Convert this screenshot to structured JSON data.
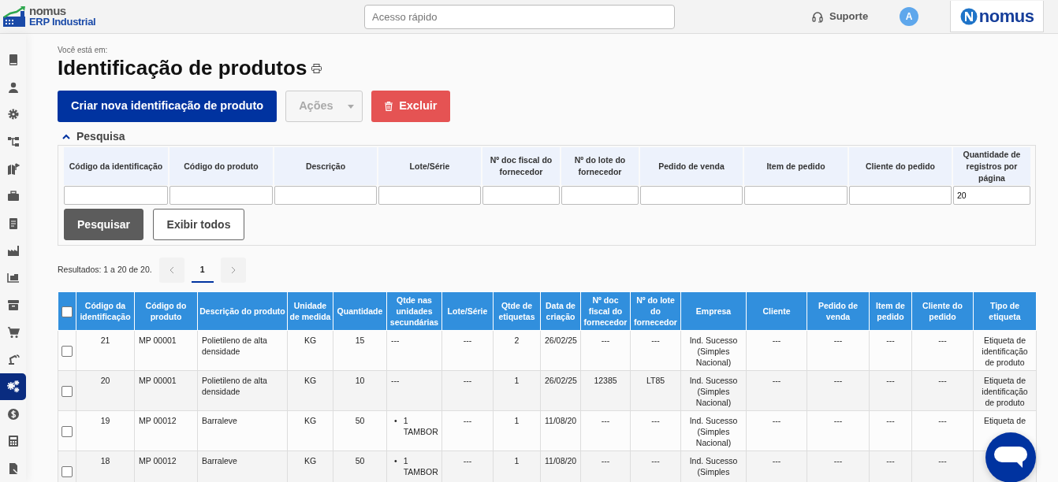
{
  "header": {
    "logo": {
      "brand": "nomus",
      "product": "ERP Industrial"
    },
    "quick_access": {
      "placeholder": "Acesso rápido"
    },
    "support": "Suporte",
    "avatar": "A",
    "brand_logo": "nomus"
  },
  "sidebar": {
    "items": [
      {
        "selected": false
      },
      {
        "selected": false
      },
      {
        "selected": false
      },
      {
        "selected": false
      },
      {
        "selected": false
      },
      {
        "selected": false
      },
      {
        "selected": false
      },
      {
        "selected": false
      },
      {
        "selected": false
      },
      {
        "selected": false
      },
      {
        "selected": false
      },
      {
        "selected": false
      },
      {
        "selected": true
      },
      {
        "selected": false
      },
      {
        "selected": false
      },
      {
        "selected": false
      }
    ]
  },
  "breadcrumb": "Você está em:",
  "title": "Identificação de produtos",
  "actions": [
    {
      "kind": "primary",
      "label": "Criar nova identificação de produto",
      "disabled": false
    },
    {
      "kind": "dropdown",
      "label": "Ações",
      "disabled": true
    },
    {
      "kind": "danger",
      "label": "Excluir",
      "disabled": false
    }
  ],
  "search": {
    "label": "Pesquisa",
    "expanded": true,
    "fields": [
      {
        "label": "Código da identificação"
      },
      {
        "label": "Código do produto"
      },
      {
        "label": "Descrição"
      },
      {
        "label": "Lote/Série"
      },
      {
        "label": "Nº doc fiscal do fornecedor"
      },
      {
        "label": "Nº do lote do fornecedor"
      },
      {
        "label": "Pedido de venda"
      },
      {
        "label": "Item de pedido"
      },
      {
        "label": "Cliente do pedido"
      },
      {
        "label": "Quantidade de registros por página",
        "value": "20"
      }
    ],
    "buttons": [
      {
        "kind": "dark",
        "label": "Pesquisar"
      },
      {
        "kind": "outline",
        "label": "Exibir todos"
      }
    ]
  },
  "results": "Resultados: 1 a 20 de 20.",
  "pagination": {
    "pages": [
      {
        "label": "1",
        "selected": true
      }
    ]
  },
  "table": {
    "select_all": false,
    "columns": [
      "Código da identificação",
      "Código do produto",
      "Descrição do produto",
      "Unidade de medida",
      "Quantidade",
      "Qtde nas unidades secundárias",
      "Lote/Série",
      "Qtde de etiquetas",
      "Data de criação",
      "Nº doc fiscal do fornecedor",
      "Nº do lote do fornecedor",
      "Empresa",
      "Cliente",
      "Pedido de venda",
      "Item de pedido",
      "Cliente do pedido",
      "Tipo de etiqueta"
    ],
    "rows": [
      {
        "checked": false,
        "cells": [
          "21",
          "MP 00001",
          "Polietileno de alta densidade",
          "KG",
          "15",
          "---",
          "---",
          "2",
          "26/02/25",
          "---",
          "---",
          "Ind. Sucesso (Simples Nacional)",
          "---",
          "---",
          "---",
          "---",
          "Etiqueta de identificação de produto"
        ]
      },
      {
        "checked": false,
        "cells": [
          "20",
          "MP 00001",
          "Polietileno de alta densidade",
          "KG",
          "10",
          "---",
          "---",
          "1",
          "26/02/25",
          "12385",
          "LT85",
          "Ind. Sucesso (Simples Nacional)",
          "---",
          "---",
          "---",
          "---",
          "Etiqueta de identificação de produto"
        ]
      },
      {
        "checked": false,
        "cells": [
          "19",
          "MP 00012",
          "Barraleve",
          "KG",
          "50",
          [
            {
              "marker": "•",
              "text": "1 TAMBOR"
            }
          ],
          "---",
          "1",
          "11/08/20",
          "---",
          "---",
          "Ind. Sucesso (Simples Nacional)",
          "---",
          "---",
          "---",
          "---",
          "Etiqueta de"
        ]
      },
      {
        "checked": false,
        "cells": [
          "18",
          "MP 00012",
          "Barraleve",
          "KG",
          "50",
          [
            {
              "marker": "•",
              "text": "1 TAMBOR"
            }
          ],
          "---",
          "1",
          "11/08/20",
          "---",
          "---",
          "Ind. Sucesso (Simples",
          "---",
          "---",
          "---",
          "---"
        ]
      }
    ]
  }
}
